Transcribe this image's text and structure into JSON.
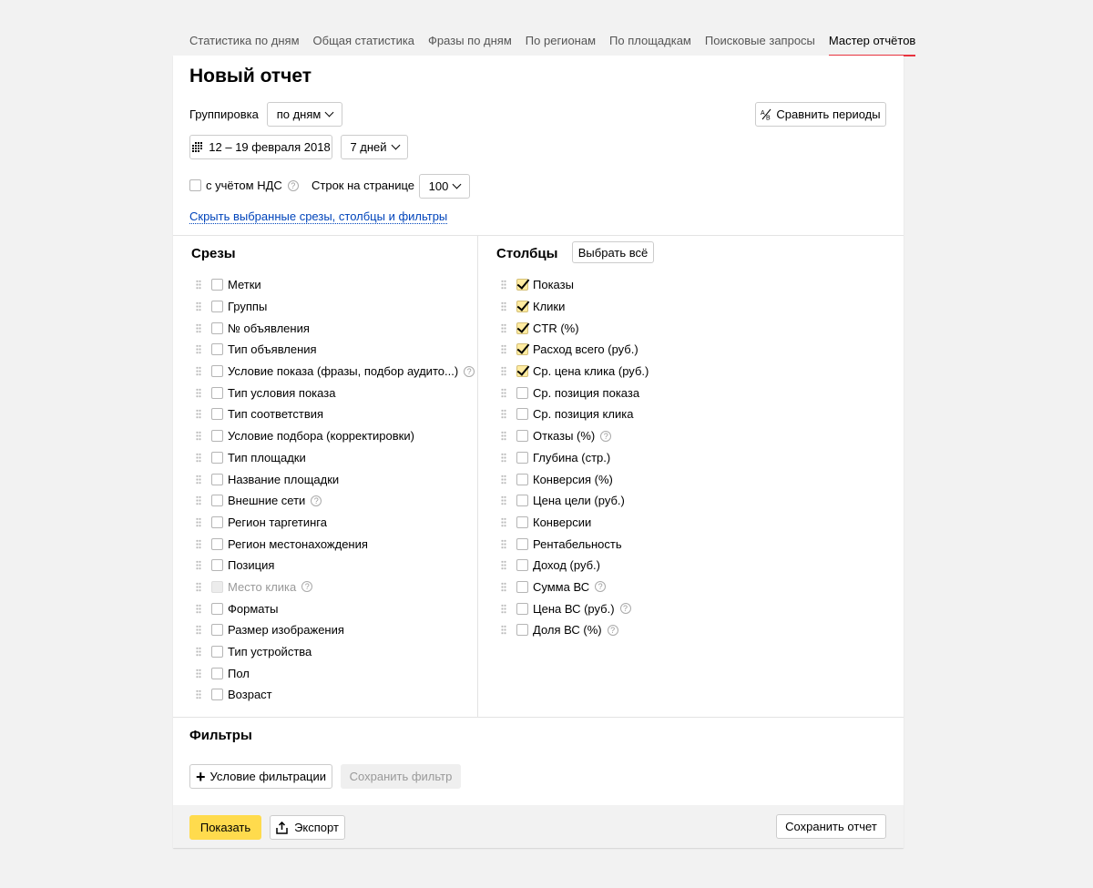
{
  "tabs": [
    {
      "label": "Статистика по дням",
      "active": false
    },
    {
      "label": "Общая статистика",
      "active": false
    },
    {
      "label": "Фразы по дням",
      "active": false
    },
    {
      "label": "По регионам",
      "active": false
    },
    {
      "label": "По площадкам",
      "active": false
    },
    {
      "label": "Поисковые запросы",
      "active": false
    },
    {
      "label": "Мастер отчётов",
      "active": true
    }
  ],
  "report": {
    "title": "Новый отчет",
    "grouping_label": "Группировка",
    "grouping_value": "по дням",
    "compare_label": "Сравнить периоды",
    "date_range": "12 – 19 февраля 2018",
    "period": "7 дней",
    "vat_label": "с учётом НДС",
    "rows_label": "Строк на странице",
    "rows_value": "100",
    "hide_link": "Скрыть выбранные срезы, столбцы и фильтры"
  },
  "slices": {
    "title": "Срезы",
    "items": [
      {
        "label": "Метки",
        "checked": false,
        "help": false,
        "disabled": false
      },
      {
        "label": "Группы",
        "checked": false,
        "help": false,
        "disabled": false
      },
      {
        "label": "№ объявления",
        "checked": false,
        "help": false,
        "disabled": false
      },
      {
        "label": "Тип объявления",
        "checked": false,
        "help": false,
        "disabled": false
      },
      {
        "label": "Условие показа (фразы, подбор аудито...)",
        "checked": false,
        "help": true,
        "disabled": false
      },
      {
        "label": "Тип условия показа",
        "checked": false,
        "help": false,
        "disabled": false
      },
      {
        "label": "Тип соответствия",
        "checked": false,
        "help": false,
        "disabled": false
      },
      {
        "label": "Условие подбора (корректировки)",
        "checked": false,
        "help": false,
        "disabled": false
      },
      {
        "label": "Тип площадки",
        "checked": false,
        "help": false,
        "disabled": false
      },
      {
        "label": "Название площадки",
        "checked": false,
        "help": false,
        "disabled": false
      },
      {
        "label": "Внешние сети",
        "checked": false,
        "help": true,
        "disabled": false
      },
      {
        "label": "Регион таргетинга",
        "checked": false,
        "help": false,
        "disabled": false
      },
      {
        "label": "Регион местонахождения",
        "checked": false,
        "help": false,
        "disabled": false
      },
      {
        "label": "Позиция",
        "checked": false,
        "help": false,
        "disabled": false
      },
      {
        "label": "Место клика",
        "checked": false,
        "help": true,
        "disabled": true
      },
      {
        "label": "Форматы",
        "checked": false,
        "help": false,
        "disabled": false
      },
      {
        "label": "Размер изображения",
        "checked": false,
        "help": false,
        "disabled": false
      },
      {
        "label": "Тип устройства",
        "checked": false,
        "help": false,
        "disabled": false
      },
      {
        "label": "Пол",
        "checked": false,
        "help": false,
        "disabled": false
      },
      {
        "label": "Возраст",
        "checked": false,
        "help": false,
        "disabled": false
      }
    ]
  },
  "columns": {
    "title": "Столбцы",
    "select_all": "Выбрать всё",
    "items": [
      {
        "label": "Показы",
        "checked": true,
        "help": false
      },
      {
        "label": "Клики",
        "checked": true,
        "help": false
      },
      {
        "label": "CTR (%)",
        "checked": true,
        "help": false
      },
      {
        "label": "Расход всего (руб.)",
        "checked": true,
        "help": false
      },
      {
        "label": "Ср. цена клика (руб.)",
        "checked": true,
        "help": false
      },
      {
        "label": "Ср. позиция показа",
        "checked": false,
        "help": false
      },
      {
        "label": "Ср. позиция клика",
        "checked": false,
        "help": false
      },
      {
        "label": "Отказы (%)",
        "checked": false,
        "help": true
      },
      {
        "label": "Глубина (стр.)",
        "checked": false,
        "help": false
      },
      {
        "label": "Конверсия (%)",
        "checked": false,
        "help": false
      },
      {
        "label": "Цена цели (руб.)",
        "checked": false,
        "help": false
      },
      {
        "label": "Конверсии",
        "checked": false,
        "help": false
      },
      {
        "label": "Рентабельность",
        "checked": false,
        "help": false
      },
      {
        "label": "Доход (руб.)",
        "checked": false,
        "help": false
      },
      {
        "label": "Сумма ВС",
        "checked": false,
        "help": true
      },
      {
        "label": "Цена ВС (руб.)",
        "checked": false,
        "help": true
      },
      {
        "label": "Доля ВС (%)",
        "checked": false,
        "help": true
      }
    ]
  },
  "filters": {
    "title": "Фильтры",
    "add_condition": "Условие фильтрации",
    "save_filter": "Сохранить фильтр"
  },
  "footer": {
    "show": "Показать",
    "export": "Экспорт",
    "save_report": "Сохранить отчет"
  },
  "colors": {
    "accent": "#ffdb4d",
    "active_tab_underline": "#e8323e",
    "link": "#0044bb"
  }
}
